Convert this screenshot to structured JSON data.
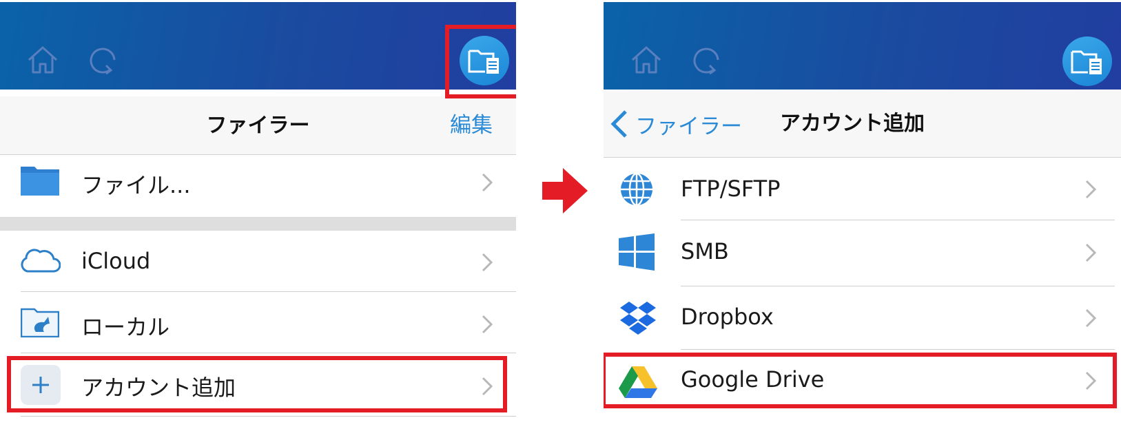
{
  "left": {
    "nav": {
      "title": "ファイラー",
      "edit_label": "編集"
    },
    "rows": [
      {
        "label": "ファイル...",
        "icon": "folder-icon"
      },
      {
        "label": "iCloud",
        "icon": "cloud-icon"
      },
      {
        "label": "ローカル",
        "icon": "local-folder-icon"
      },
      {
        "label": "アカウント追加",
        "icon": "plus-icon"
      }
    ]
  },
  "right": {
    "nav": {
      "back_label": "ファイラー",
      "title": "アカウント追加"
    },
    "rows": [
      {
        "label": "FTP/SFTP",
        "icon": "globe-icon"
      },
      {
        "label": "SMB",
        "icon": "windows-icon"
      },
      {
        "label": "Dropbox",
        "icon": "dropbox-icon"
      },
      {
        "label": "Google Drive",
        "icon": "google-drive-icon"
      }
    ]
  },
  "colors": {
    "appbar_start": "#0a63a8",
    "appbar_end": "#213ea0",
    "accent_blue": "#2a8ad6",
    "highlight_red": "#e41c25"
  }
}
